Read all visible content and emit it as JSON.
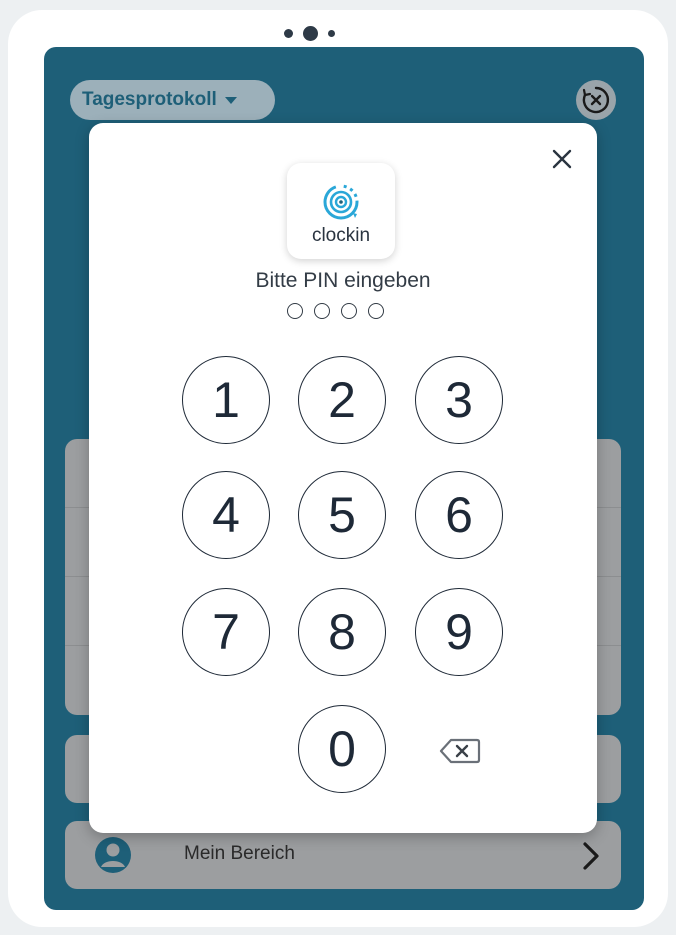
{
  "pager": {
    "dots": 3,
    "active_index": 1
  },
  "header": {
    "report_dropdown": "Tagesprotokoll"
  },
  "bottom_nav": {
    "my_area_label": "Mein Bereich"
  },
  "pin_dialog": {
    "logo_text": "clockin",
    "prompt": "Bitte PIN eingeben",
    "pin_length": 4,
    "keys": [
      "1",
      "2",
      "3",
      "4",
      "5",
      "6",
      "7",
      "8",
      "9",
      "0"
    ]
  },
  "colors": {
    "app_background": "#1e5f78",
    "overlay_card": "#9c9ea0",
    "key_stroke": "#1e2937",
    "logo_accent": "#2aa7d8"
  }
}
